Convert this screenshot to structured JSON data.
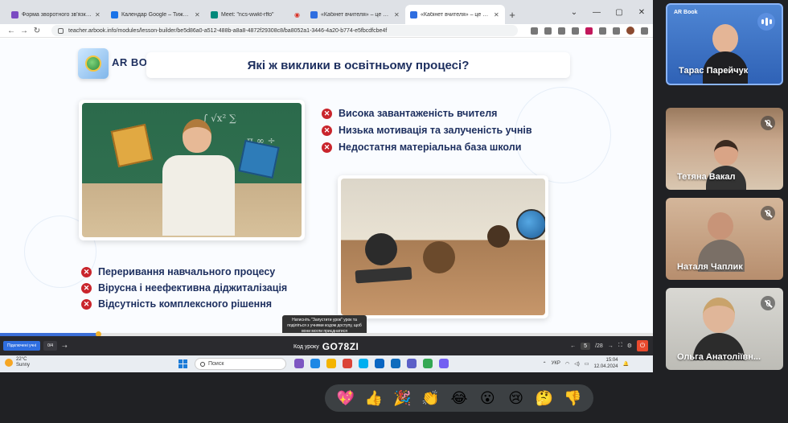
{
  "browser": {
    "tabs": [
      {
        "title": "Форма зворотного зв'язку по",
        "color": "#7b4cc2",
        "active": false
      },
      {
        "title": "Календар Google – Тиждень (",
        "color": "#1a73e8",
        "active": false
      },
      {
        "title": "Meet: \"ncs-wwkt-rffo\"",
        "color": "#00897b",
        "active": false
      },
      {
        "title": "«Кабінет вчителя» – це зручн",
        "color": "#2f6ee0",
        "active": false
      },
      {
        "title": "«Кабінет вчителя» – це зручн",
        "color": "#2f6ee0",
        "active": true
      }
    ],
    "new_tab": "+",
    "window_controls": [
      "⌄",
      "—",
      "▢",
      "✕"
    ],
    "url": "teacher.arbook.info/modules/lesson-builder/be5d86a0-a512-488b-a8a8-4872f29308c8/ba8052a1-3446-4a20-b774-e5fbcdfcbe4f"
  },
  "slide": {
    "brand": "AR BOOK",
    "title": "Які ж виклики в освітньому процесі?",
    "challenges_top": [
      "Висока завантаженість вчителя",
      "Низька мотивація та залученість учнів",
      "Недостатня матеріальна база школи"
    ],
    "challenges_bottom": [
      "Переривання навчального процесу",
      "Вірусна і неефективна діджиталізація",
      "Відсутність комплексного рішення"
    ],
    "tooltip": "Натисніть \"Запустити урок\" урок та поділіться з учнями кодом доступу, щоб вони могли приєднатися"
  },
  "lesson_bar": {
    "progress_fraction": 0.15,
    "btn_connected": "Підключені учні",
    "btn_count": "0/4",
    "code_label": "Код уроку",
    "code": "GO78ZI",
    "page": "5",
    "total": "/28"
  },
  "taskbar": {
    "temp": "22°C",
    "weather": "Sunny",
    "search": "Поиск",
    "lang": "УКР",
    "time": "15:04",
    "date": "12.04.2024",
    "icons": [
      {
        "name": "copilot-icon",
        "color": "#7e57c2"
      },
      {
        "name": "edge-icon",
        "color": "#1e88e5"
      },
      {
        "name": "explorer-icon",
        "color": "#f4b400"
      },
      {
        "name": "chrome-icon",
        "color": "#db4437"
      },
      {
        "name": "skype-icon",
        "color": "#00aff0"
      },
      {
        "name": "mail-icon",
        "color": "#0a66c2"
      },
      {
        "name": "outlook-icon",
        "color": "#0f6cbd"
      },
      {
        "name": "teams-icon",
        "color": "#5b5fc7"
      },
      {
        "name": "chrome-profile-icon",
        "color": "#34a853"
      },
      {
        "name": "viber-icon",
        "color": "#7360f2"
      }
    ]
  },
  "participants": [
    {
      "name": "Тарас Парейчук",
      "speaking": true
    },
    {
      "name": "Тетяна Вакал",
      "muted": true
    },
    {
      "name": "Наталя Чаплик",
      "muted": true
    },
    {
      "name": "Ольга Анатоліївн...",
      "muted": true
    }
  ],
  "presenter_tile_brand": "AR Book",
  "reactions": [
    "💖",
    "👍",
    "🎉",
    "👏",
    "😂",
    "😮",
    "😢",
    "🤔",
    "👎"
  ]
}
